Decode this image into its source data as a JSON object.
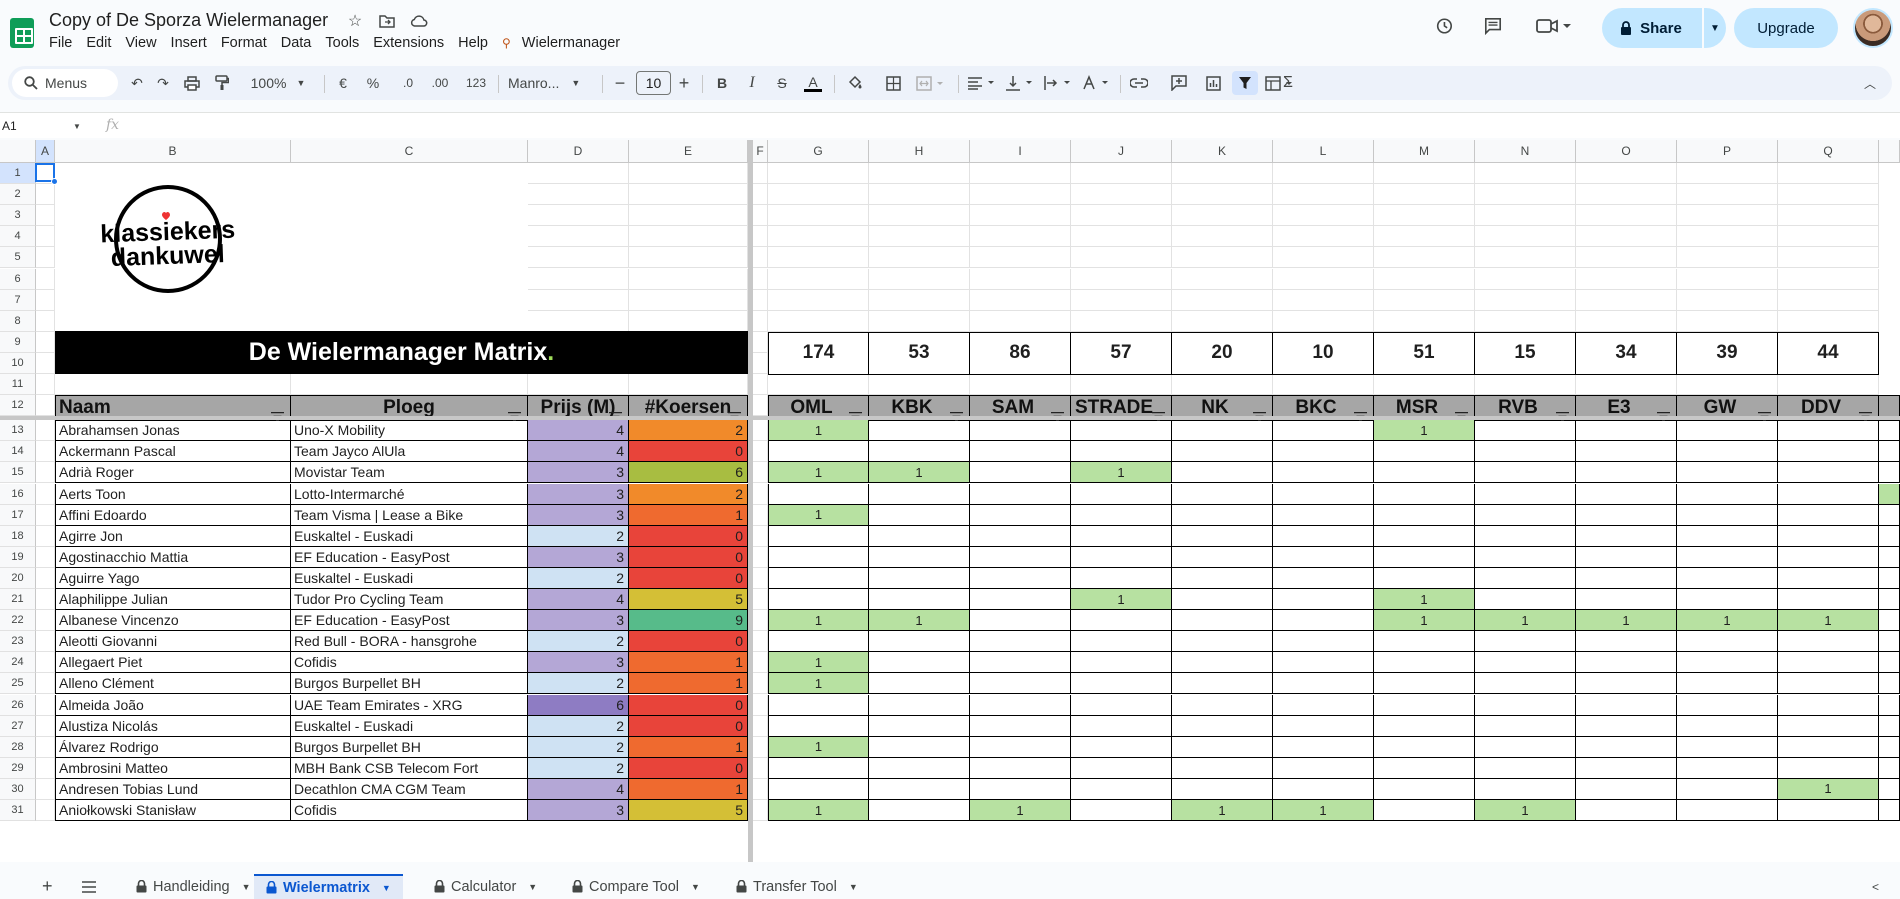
{
  "app": {
    "doc_title": "Copy of De Sporza Wielermanager",
    "menus": [
      "File",
      "Edit",
      "View",
      "Insert",
      "Format",
      "Data",
      "Tools",
      "Extensions",
      "Help"
    ],
    "custom_menu": "Wielermanager",
    "share_label": "Share",
    "upgrade_label": "Upgrade"
  },
  "toolbar": {
    "search_label": "Menus",
    "zoom": "100%",
    "currency": "€",
    "percent": "%",
    "dec_decrease": ".0",
    "dec_increase": ".00",
    "number_format": "123",
    "font": "Manro...",
    "font_size": "10",
    "bold": "B",
    "italic": "I",
    "strike": "S",
    "text_color": "A",
    "sigma": "Σ"
  },
  "formula_bar": {
    "cell_ref": "A1",
    "fx": "fx"
  },
  "sheet": {
    "col_letters": [
      "A",
      "B",
      "C",
      "D",
      "E",
      "F",
      "G",
      "H",
      "I",
      "J",
      "K",
      "L",
      "M",
      "N",
      "O",
      "P",
      "Q"
    ],
    "row_numbers": [
      "1",
      "2",
      "3",
      "4",
      "5",
      "6",
      "7",
      "8",
      "9",
      "10",
      "11",
      "12",
      "13",
      "14",
      "15",
      "16",
      "17",
      "18",
      "19",
      "20",
      "21",
      "22",
      "23",
      "24",
      "25",
      "26",
      "27",
      "28",
      "29",
      "30",
      "31"
    ],
    "banner_title": "De Wielermanager Matrix",
    "banner_dot": ".",
    "logo_text_1": "klassiekers",
    "logo_text_2": "dankuwel",
    "headers": [
      "Naam",
      "Ploeg",
      "Prijs (M)",
      "#Koersen"
    ],
    "races": [
      "OML",
      "KBK",
      "SAM",
      "STRADE",
      "NK",
      "BKC",
      "MSR",
      "RVB",
      "E3",
      "GW",
      "DDV"
    ],
    "race_totals": [
      "174",
      "53",
      "86",
      "57",
      "20",
      "10",
      "51",
      "15",
      "34",
      "39",
      "44"
    ],
    "riders": [
      {
        "name": "Abrahamsen Jonas",
        "team": "Uno-X Mobility",
        "price": "4",
        "races": "2",
        "flags": [
          "1",
          "",
          "",
          "",
          "",
          "",
          "1",
          "",
          "",
          "",
          ""
        ]
      },
      {
        "name": "Ackermann Pascal",
        "team": "Team Jayco AlUla",
        "price": "4",
        "races": "0",
        "flags": [
          "",
          "",
          "",
          "",
          "",
          "",
          "",
          "",
          "",
          "",
          ""
        ]
      },
      {
        "name": "Adrià Roger",
        "team": "Movistar Team",
        "price": "3",
        "races": "6",
        "flags": [
          "1",
          "1",
          "",
          "1",
          "",
          "",
          "",
          "",
          "",
          "",
          ""
        ]
      },
      {
        "name": "Aerts Toon",
        "team": "Lotto-Intermarché",
        "price": "3",
        "races": "2",
        "flags": [
          "",
          "",
          "",
          "",
          "",
          "",
          "",
          "",
          "",
          "",
          ""
        ]
      },
      {
        "name": "Affini Edoardo",
        "team": "Team Visma | Lease a Bike",
        "price": "3",
        "races": "1",
        "flags": [
          "1",
          "",
          "",
          "",
          "",
          "",
          "",
          "",
          "",
          "",
          ""
        ]
      },
      {
        "name": "Agirre Jon",
        "team": "Euskaltel - Euskadi",
        "price": "2",
        "races": "0",
        "flags": [
          "",
          "",
          "",
          "",
          "",
          "",
          "",
          "",
          "",
          "",
          ""
        ]
      },
      {
        "name": "Agostinacchio Mattia",
        "team": "EF Education - EasyPost",
        "price": "3",
        "races": "0",
        "flags": [
          "",
          "",
          "",
          "",
          "",
          "",
          "",
          "",
          "",
          "",
          ""
        ]
      },
      {
        "name": "Aguirre Yago",
        "team": "Euskaltel - Euskadi",
        "price": "2",
        "races": "0",
        "flags": [
          "",
          "",
          "",
          "",
          "",
          "",
          "",
          "",
          "",
          "",
          ""
        ]
      },
      {
        "name": "Alaphilippe Julian",
        "team": "Tudor Pro Cycling Team",
        "price": "4",
        "races": "5",
        "flags": [
          "",
          "",
          "",
          "1",
          "",
          "",
          "1",
          "",
          "",
          "",
          ""
        ]
      },
      {
        "name": "Albanese Vincenzo",
        "team": "EF Education - EasyPost",
        "price": "3",
        "races": "9",
        "flags": [
          "1",
          "1",
          "",
          "",
          "",
          "",
          "1",
          "1",
          "1",
          "1",
          "1"
        ]
      },
      {
        "name": "Aleotti Giovanni",
        "team": "Red Bull - BORA - hansgrohe",
        "price": "2",
        "races": "0",
        "flags": [
          "",
          "",
          "",
          "",
          "",
          "",
          "",
          "",
          "",
          "",
          ""
        ]
      },
      {
        "name": "Allegaert Piet",
        "team": "Cofidis",
        "price": "3",
        "races": "1",
        "flags": [
          "1",
          "",
          "",
          "",
          "",
          "",
          "",
          "",
          "",
          "",
          ""
        ]
      },
      {
        "name": "Alleno Clément",
        "team": "Burgos Burpellet BH",
        "price": "2",
        "races": "1",
        "flags": [
          "1",
          "",
          "",
          "",
          "",
          "",
          "",
          "",
          "",
          "",
          ""
        ]
      },
      {
        "name": "Almeida João",
        "team": "UAE Team Emirates - XRG",
        "price": "6",
        "races": "0",
        "flags": [
          "",
          "",
          "",
          "",
          "",
          "",
          "",
          "",
          "",
          "",
          ""
        ]
      },
      {
        "name": "Alustiza Nicolás",
        "team": "Euskaltel - Euskadi",
        "price": "2",
        "races": "0",
        "flags": [
          "",
          "",
          "",
          "",
          "",
          "",
          "",
          "",
          "",
          "",
          ""
        ]
      },
      {
        "name": "Álvarez Rodrigo",
        "team": "Burgos Burpellet BH",
        "price": "2",
        "races": "1",
        "flags": [
          "1",
          "",
          "",
          "",
          "",
          "",
          "",
          "",
          "",
          "",
          ""
        ]
      },
      {
        "name": "Ambrosini Matteo",
        "team": "MBH Bank CSB Telecom Fort",
        "price": "2",
        "races": "0",
        "flags": [
          "",
          "",
          "",
          "",
          "",
          "",
          "",
          "",
          "",
          "",
          ""
        ]
      },
      {
        "name": "Andresen Tobias Lund",
        "team": "Decathlon CMA CGM Team",
        "price": "4",
        "races": "1",
        "flags": [
          "",
          "",
          "",
          "",
          "",
          "",
          "",
          "",
          "",
          "",
          "1"
        ]
      },
      {
        "name": "Aniołkowski Stanisław",
        "team": "Cofidis",
        "price": "3",
        "races": "5",
        "flags": [
          "1",
          "",
          "1",
          "",
          "1",
          "1",
          "",
          "1",
          "",
          "",
          ""
        ]
      }
    ]
  },
  "tabs": [
    {
      "label": "Handleiding",
      "active": false
    },
    {
      "label": "Wielermatrix",
      "active": true
    },
    {
      "label": "Calculator",
      "active": false
    },
    {
      "label": "Compare Tool",
      "active": false
    },
    {
      "label": "Transfer Tool",
      "active": false
    }
  ],
  "colors": {
    "match_green": "#b7e1a1",
    "price_low": "#cfe2f3",
    "price_mid": "#b4a7d6",
    "price_high": "#8e7cc3",
    "races_0": "#e8443a",
    "races_1": "#ef6a2f",
    "races_2": "#f18a2a",
    "races_5": "#d4bf36",
    "races_6": "#a8bd41",
    "races_9": "#57bb8a",
    "header_gray": "#a6a6a6"
  }
}
